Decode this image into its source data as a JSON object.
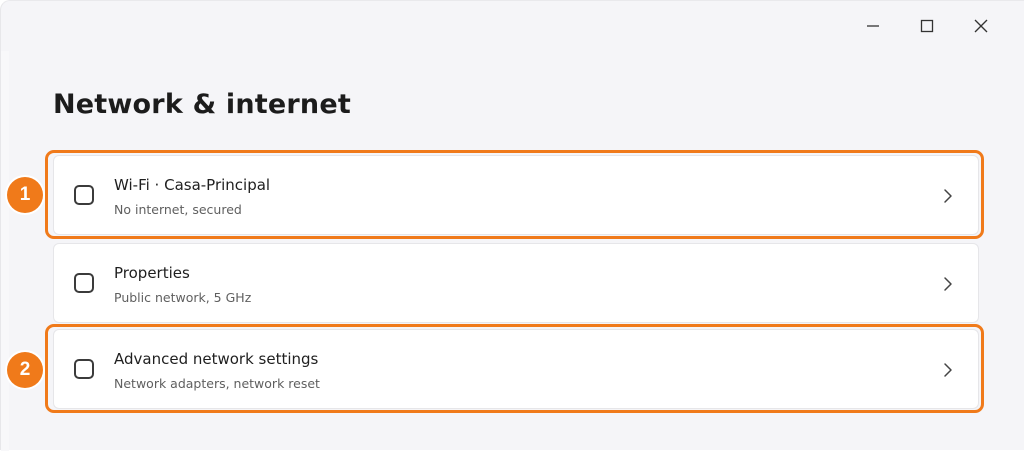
{
  "window": {
    "controls": {
      "minimize_icon": "minimize-icon",
      "maximize_icon": "maximize-icon",
      "close_icon": "close-icon"
    }
  },
  "page": {
    "title": "Network & internet"
  },
  "items": [
    {
      "title": "Wi-Fi · Casa-Principal",
      "subtitle": "No internet, secured",
      "icon": "wifi-icon"
    },
    {
      "title": "Properties",
      "subtitle": "Public network, 5 GHz",
      "icon": "properties-icon"
    },
    {
      "title": "Advanced network settings",
      "subtitle": "Network adapters, network reset",
      "icon": "advanced-network-icon"
    }
  ],
  "annotations": [
    {
      "label": "1",
      "target": "items.0"
    },
    {
      "label": "2",
      "target": "items.2"
    }
  ],
  "colors": {
    "accent": "#f07a1a",
    "background": "#f5f5f8",
    "card": "#ffffff"
  }
}
